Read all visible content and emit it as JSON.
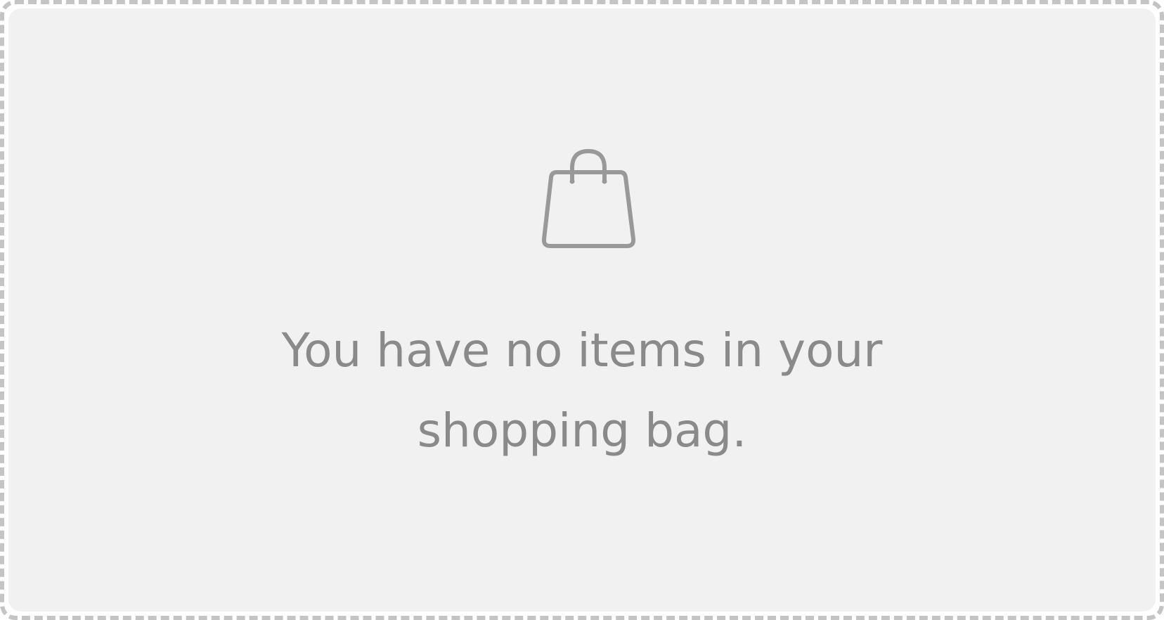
{
  "empty_state": {
    "icon": "shopping-bag-icon",
    "message_line1": "You have no items in your",
    "message_line2": "shopping bag."
  },
  "colors": {
    "card_background": "#f1f1f1",
    "dashed_border": "#c4c4c4",
    "icon_stroke": "#999999",
    "text": "#8a8a8a"
  }
}
